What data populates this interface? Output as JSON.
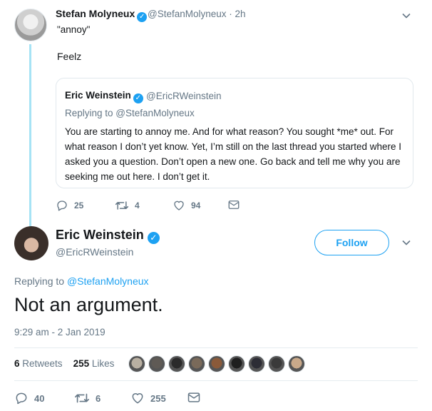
{
  "tweet1": {
    "name": "Stefan Molyneux",
    "handle_time": "@StefanMolyneux · 2h",
    "quote_text": "\"annoy\"",
    "body": "Feelz",
    "quoted": {
      "name": "Eric Weinstein",
      "handle": "@EricRWeinstein",
      "replying_prefix": "Replying to ",
      "replying_to": "@StefanMolyneux",
      "body": "You are starting to annoy me. And for what reason? You sought *me* out. For what reason I don’t yet know. Yet, I’m still on the last thread you started where I asked you a question. Don’t open a new one. Go back and tell me why you are seeking me out here. I don’t get it."
    },
    "actions": {
      "replies": "25",
      "retweets": "4",
      "likes": "94"
    }
  },
  "tweet2": {
    "name": "Eric Weinstein",
    "handle": "@EricRWeinstein",
    "follow_label": "Follow",
    "replying_prefix": "Replying to ",
    "replying_to": "@StefanMolyneux",
    "text": "Not an argument.",
    "timestamp": "9:29 am - 2 Jan 2019",
    "stats": {
      "retweets_count": "6",
      "retweets_label": "Retweets",
      "likes_count": "255",
      "likes_label": "Likes"
    },
    "liker_colors": [
      "#b9b0a2",
      "#5f5a55",
      "#2b2b2b",
      "#7a6a5a",
      "#8a5a3a",
      "#1f1f1f",
      "#2d2d35",
      "#3a3a3a",
      "#c9a98a"
    ],
    "actions": {
      "replies": "40",
      "retweets": "6",
      "likes": "255"
    }
  },
  "colors": {
    "accent": "#1da1f2",
    "muted": "#657786",
    "thread_line": "#a6e3f5"
  }
}
